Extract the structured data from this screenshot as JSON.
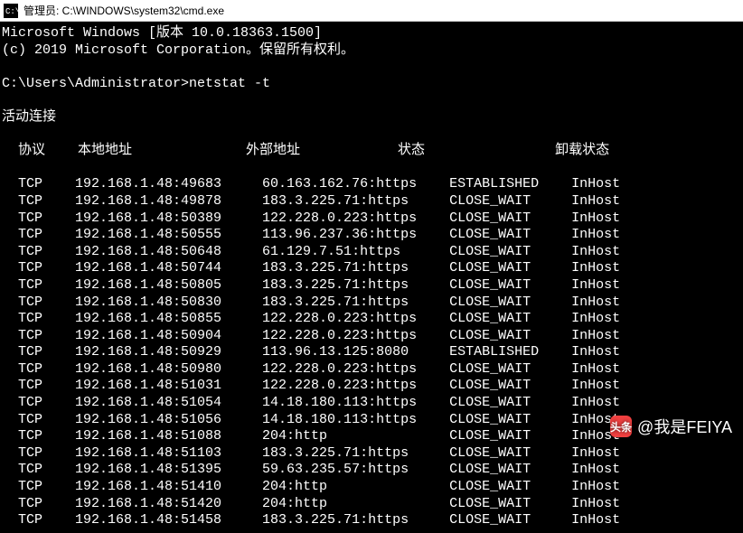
{
  "titlebar": {
    "text": "管理员: C:\\WINDOWS\\system32\\cmd.exe"
  },
  "header": {
    "line1": "Microsoft Windows [版本 10.0.18363.1500]",
    "line2": "(c) 2019 Microsoft Corporation。保留所有权利。"
  },
  "prompt": {
    "path": "C:\\Users\\Administrator>",
    "command": "netstat -t"
  },
  "section_title": "活动连接",
  "columns": {
    "proto": "协议",
    "local": "本地地址",
    "foreign": "外部地址",
    "state": "状态",
    "offload": "卸载状态"
  },
  "rows": [
    {
      "proto": "TCP",
      "local": "192.168.1.48:49683",
      "foreign": "60.163.162.76:https",
      "state": "ESTABLISHED",
      "offload": "InHost"
    },
    {
      "proto": "TCP",
      "local": "192.168.1.48:49878",
      "foreign": "183.3.225.71:https",
      "state": "CLOSE_WAIT",
      "offload": "InHost"
    },
    {
      "proto": "TCP",
      "local": "192.168.1.48:50389",
      "foreign": "122.228.0.223:https",
      "state": "CLOSE_WAIT",
      "offload": "InHost"
    },
    {
      "proto": "TCP",
      "local": "192.168.1.48:50555",
      "foreign": "113.96.237.36:https",
      "state": "CLOSE_WAIT",
      "offload": "InHost"
    },
    {
      "proto": "TCP",
      "local": "192.168.1.48:50648",
      "foreign": "61.129.7.51:https",
      "state": "CLOSE_WAIT",
      "offload": "InHost"
    },
    {
      "proto": "TCP",
      "local": "192.168.1.48:50744",
      "foreign": "183.3.225.71:https",
      "state": "CLOSE_WAIT",
      "offload": "InHost"
    },
    {
      "proto": "TCP",
      "local": "192.168.1.48:50805",
      "foreign": "183.3.225.71:https",
      "state": "CLOSE_WAIT",
      "offload": "InHost"
    },
    {
      "proto": "TCP",
      "local": "192.168.1.48:50830",
      "foreign": "183.3.225.71:https",
      "state": "CLOSE_WAIT",
      "offload": "InHost"
    },
    {
      "proto": "TCP",
      "local": "192.168.1.48:50855",
      "foreign": "122.228.0.223:https",
      "state": "CLOSE_WAIT",
      "offload": "InHost"
    },
    {
      "proto": "TCP",
      "local": "192.168.1.48:50904",
      "foreign": "122.228.0.223:https",
      "state": "CLOSE_WAIT",
      "offload": "InHost"
    },
    {
      "proto": "TCP",
      "local": "192.168.1.48:50929",
      "foreign": "113.96.13.125:8080",
      "state": "ESTABLISHED",
      "offload": "InHost"
    },
    {
      "proto": "TCP",
      "local": "192.168.1.48:50980",
      "foreign": "122.228.0.223:https",
      "state": "CLOSE_WAIT",
      "offload": "InHost"
    },
    {
      "proto": "TCP",
      "local": "192.168.1.48:51031",
      "foreign": "122.228.0.223:https",
      "state": "CLOSE_WAIT",
      "offload": "InHost"
    },
    {
      "proto": "TCP",
      "local": "192.168.1.48:51054",
      "foreign": "14.18.180.113:https",
      "state": "CLOSE_WAIT",
      "offload": "InHost"
    },
    {
      "proto": "TCP",
      "local": "192.168.1.48:51056",
      "foreign": "14.18.180.113:https",
      "state": "CLOSE_WAIT",
      "offload": "InHost"
    },
    {
      "proto": "TCP",
      "local": "192.168.1.48:51088",
      "foreign": "204:http",
      "state": "CLOSE_WAIT",
      "offload": "InHost"
    },
    {
      "proto": "TCP",
      "local": "192.168.1.48:51103",
      "foreign": "183.3.225.71:https",
      "state": "CLOSE_WAIT",
      "offload": "InHost"
    },
    {
      "proto": "TCP",
      "local": "192.168.1.48:51395",
      "foreign": "59.63.235.57:https",
      "state": "CLOSE_WAIT",
      "offload": "InHost"
    },
    {
      "proto": "TCP",
      "local": "192.168.1.48:51410",
      "foreign": "204:http",
      "state": "CLOSE_WAIT",
      "offload": "InHost"
    },
    {
      "proto": "TCP",
      "local": "192.168.1.48:51420",
      "foreign": "204:http",
      "state": "CLOSE_WAIT",
      "offload": "InHost"
    },
    {
      "proto": "TCP",
      "local": "192.168.1.48:51458",
      "foreign": "183.3.225.71:https",
      "state": "CLOSE_WAIT",
      "offload": "InHost"
    }
  ],
  "watermark": {
    "text": "@我是FEIYA",
    "logo_label": "头条"
  }
}
